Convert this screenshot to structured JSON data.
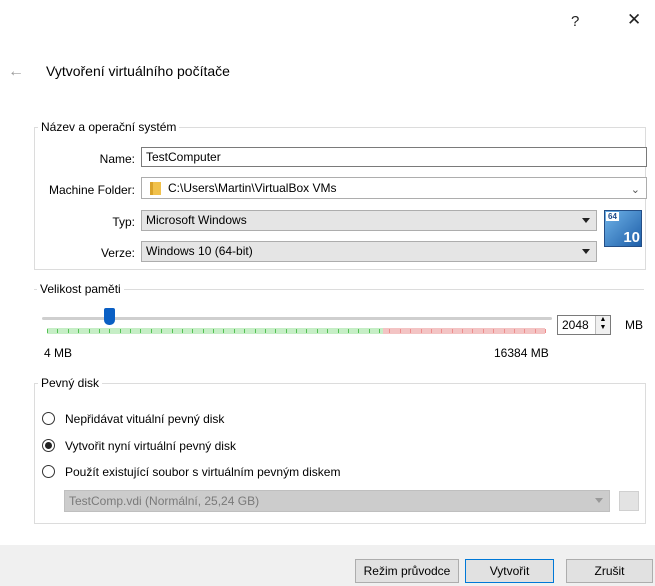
{
  "window": {
    "help_label": "?",
    "close_label": "✕"
  },
  "header": {
    "back_icon": "arrow-left-icon",
    "title": "Vytvoření virtuálního počítače"
  },
  "name_os": {
    "legend": "Název a operační systém",
    "name_label": "Name:",
    "name_value": "TestComputer",
    "folder_label": "Machine Folder:",
    "folder_value": "C:\\Users\\Martin\\VirtualBox VMs",
    "type_label": "Typ:",
    "type_value": "Microsoft Windows",
    "version_label": "Verze:",
    "version_value": "Windows 10 (64-bit)",
    "os_badge_top": "64",
    "os_badge_bottom": "10"
  },
  "memory": {
    "legend": "Velikost paměti",
    "value": "2048",
    "unit": "MB",
    "min_label": "4 MB",
    "max_label": "16384 MB",
    "min_mb": 4,
    "max_mb": 16384,
    "current_mb": 2048,
    "colors": {
      "ok": "#54c154",
      "warn": "#ee8d8d",
      "thumb": "#0a5fc4"
    }
  },
  "disk": {
    "legend": "Pevný disk",
    "options": [
      {
        "label": "Nepřidávat vituální pevný disk",
        "checked": false
      },
      {
        "label": "Vytvořit nyní virtuální pevný disk",
        "checked": true
      },
      {
        "label": "Použít existující soubor s virtuálním pevným diskem",
        "checked": false
      }
    ],
    "existing_file": "TestComp.vdi (Normální, 25,24 GB)"
  },
  "footer": {
    "wizard_label": "Režim průvodce",
    "create_label": "Vytvořit",
    "cancel_label": "Zrušit"
  }
}
